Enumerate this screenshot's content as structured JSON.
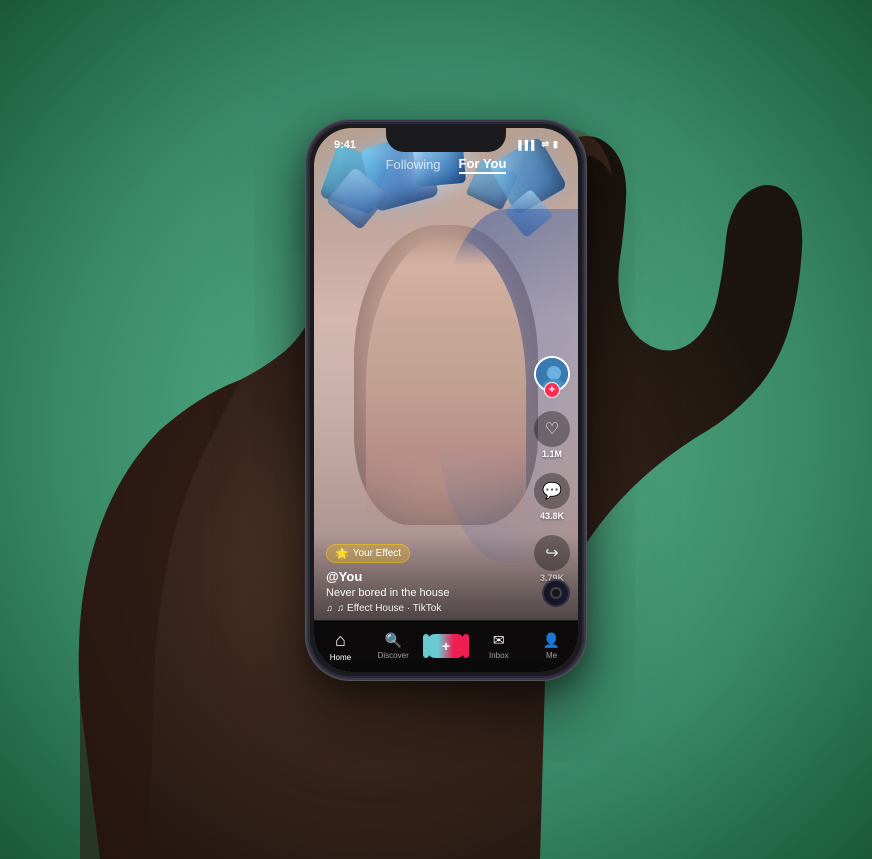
{
  "statusBar": {
    "time": "9:41",
    "signal": "▌▌▌",
    "wifi": "WiFi",
    "battery": "⬛"
  },
  "topNav": {
    "following": "Following",
    "forYou": "For You",
    "active": "forYou"
  },
  "video": {
    "effect": {
      "icon": "🌟",
      "label": "Your Effect"
    },
    "username": "@You",
    "caption": "Never bored in the house",
    "sound": "♫ Effect House · TikTok"
  },
  "actions": {
    "like": {
      "count": "1.1M",
      "icon": "♡"
    },
    "comment": {
      "count": "43.8K",
      "icon": "💬"
    },
    "share": {
      "count": "3.79K",
      "icon": "↪"
    }
  },
  "bottomNav": {
    "items": [
      {
        "id": "home",
        "label": "Home",
        "icon": "⌂",
        "active": true
      },
      {
        "id": "discover",
        "label": "Discover",
        "icon": "🔍",
        "active": false
      },
      {
        "id": "add",
        "label": "",
        "icon": "+",
        "active": false
      },
      {
        "id": "inbox",
        "label": "Inbox",
        "icon": "✉",
        "active": false
      },
      {
        "id": "me",
        "label": "Me",
        "icon": "👤",
        "active": false
      }
    ]
  },
  "colors": {
    "primary": "#fe2c55",
    "secondary": "#69c9d0",
    "background": "#3a8a6a",
    "navBg": "rgba(0,0,0,0.92)"
  }
}
